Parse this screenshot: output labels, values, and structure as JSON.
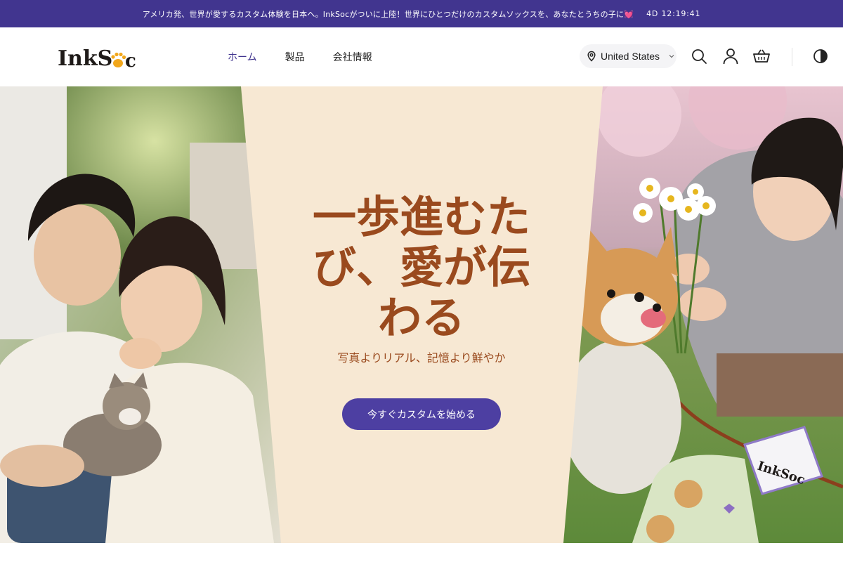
{
  "announcement": {
    "message": "アメリカ発、世界が愛するカスタム体験を日本へ。InkSocがついに上陸！世界にひとつだけのカスタムソックスを、あなたとうちの子に💓",
    "countdown": "4D  12:19:41"
  },
  "header": {
    "logo_text": "InkSoc",
    "nav": [
      {
        "label": "ホーム",
        "active": true
      },
      {
        "label": "製品",
        "active": false
      },
      {
        "label": "会社情報",
        "active": false
      }
    ],
    "country": "United States",
    "icons": [
      "location-pin-icon",
      "search-icon",
      "account-icon",
      "cart-icon",
      "contrast-toggle-icon"
    ]
  },
  "hero": {
    "title": "一歩進むたび、愛が伝わる",
    "subtitle": "写真よりリアル、記憶より鮮やか",
    "cta_label": "今すぐカスタムを始める",
    "left_image": "couple-with-cat-photo",
    "right_image": "woman-with-shiba-dog-and-daisies-photo",
    "package_logo_text": "InkSoc"
  },
  "colors": {
    "brand": "#41358f",
    "button": "#4d3fa2",
    "panel": "#f7e8d3",
    "headline": "#9a4a1e",
    "paw_accent": "#f2a71b"
  }
}
